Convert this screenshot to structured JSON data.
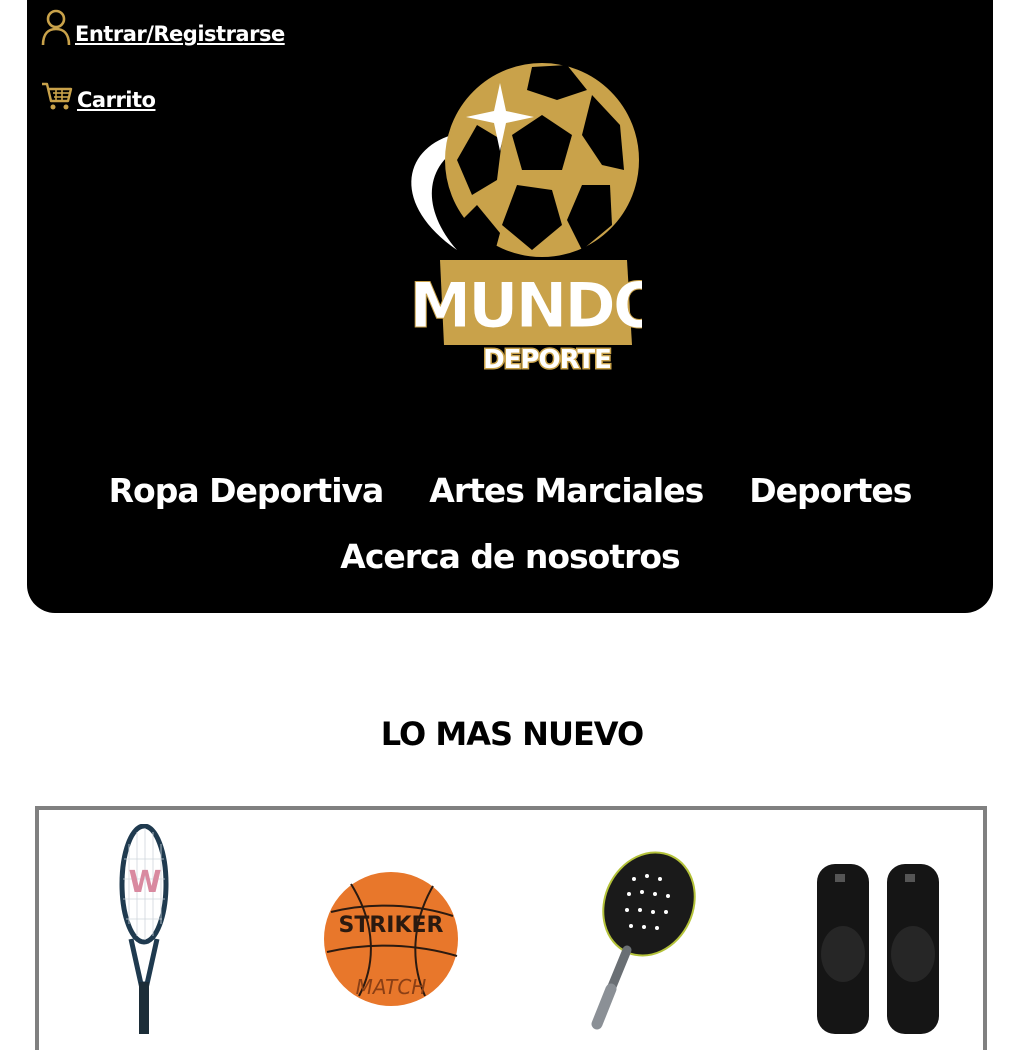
{
  "header": {
    "login_label": "Entrar/Registrarse",
    "cart_label": "Carrito",
    "logo": {
      "title": "MUNDO",
      "subtitle": "DEPORTE"
    },
    "nav": [
      {
        "label": "Ropa Deportiva"
      },
      {
        "label": "Artes Marciales"
      },
      {
        "label": "Deportes"
      },
      {
        "label": "Acerca de nosotros"
      }
    ]
  },
  "colors": {
    "header_bg": "#000000",
    "gold": "#c9a24a",
    "text_light": "#ffffff",
    "products_border": "#808080"
  },
  "section": {
    "title": "LO MAS NUEVO"
  },
  "products": [
    {
      "icon": "tennis-racket-icon",
      "brand": "W"
    },
    {
      "icon": "basketball-icon",
      "brand": "STRIKER",
      "model": "MATCH"
    },
    {
      "icon": "padel-racket-icon",
      "brand": ""
    },
    {
      "icon": "knee-pads-icon",
      "brand": ""
    }
  ]
}
